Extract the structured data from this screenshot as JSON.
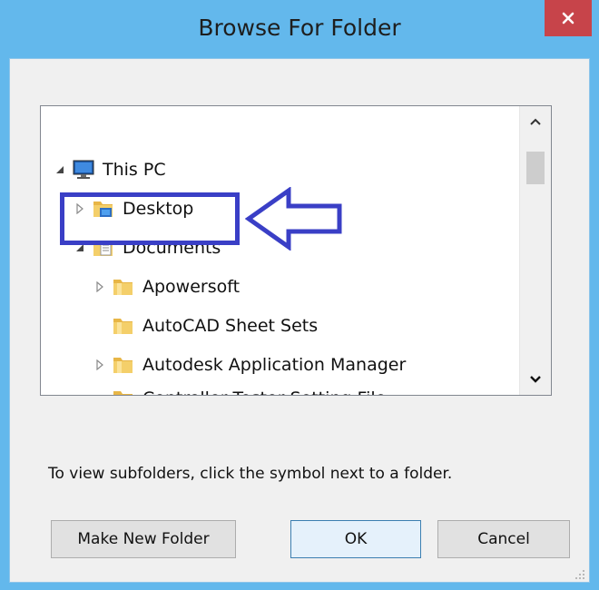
{
  "window": {
    "title": "Browse For Folder",
    "close_label": "×"
  },
  "tree": {
    "items": [
      {
        "label": "This PC",
        "icon": "computer-icon",
        "expander": "expanded"
      },
      {
        "label": "Desktop",
        "icon": "desktop-folder-icon",
        "expander": "collapsed",
        "highlighted": true
      },
      {
        "label": "Documents",
        "icon": "documents-folder-icon",
        "expander": "expanded"
      },
      {
        "label": "Apowersoft",
        "icon": "folder-icon",
        "expander": "collapsed"
      },
      {
        "label": "AutoCAD Sheet Sets",
        "icon": "folder-icon",
        "expander": "none"
      },
      {
        "label": "Autodesk Application Manager",
        "icon": "folder-icon",
        "expander": "collapsed"
      },
      {
        "label": "Controller Tester Setting File",
        "icon": "folder-icon",
        "expander": "none"
      }
    ]
  },
  "hint_text": "To view subfolders, click the symbol next to a folder.",
  "buttons": {
    "make_new_folder": "Make New Folder",
    "ok": "OK",
    "cancel": "Cancel"
  },
  "colors": {
    "titlebar": "#63b8ec",
    "close": "#c7444a",
    "annotation": "#3a3fc6"
  }
}
